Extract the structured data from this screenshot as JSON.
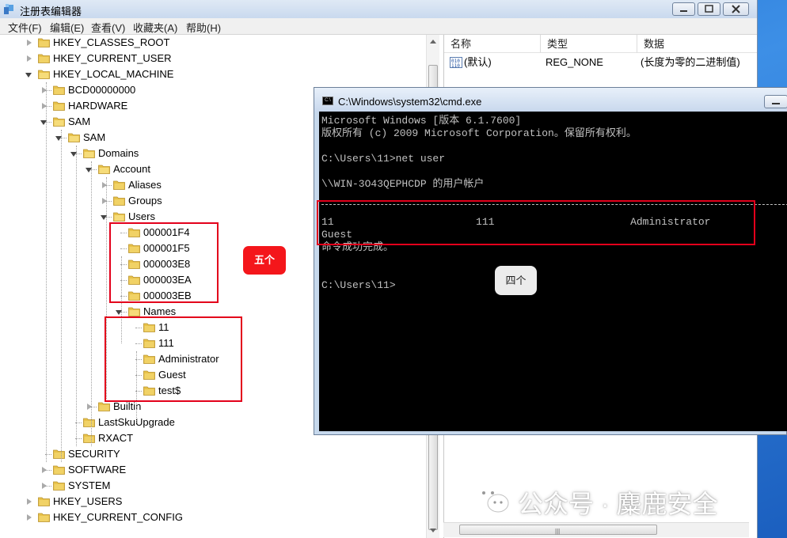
{
  "window": {
    "title": "注册表编辑器",
    "menu": [
      "文件(F)",
      "编辑(E)",
      "查看(V)",
      "收藏夹(A)",
      "帮助(H)"
    ]
  },
  "tree": {
    "items": [
      {
        "label": "HKEY_CLASSES_ROOT",
        "state": "collapsed"
      },
      {
        "label": "HKEY_CURRENT_USER",
        "state": "collapsed"
      },
      {
        "label": "HKEY_LOCAL_MACHINE",
        "state": "expanded"
      },
      {
        "label": "BCD00000000",
        "state": "collapsed"
      },
      {
        "label": "HARDWARE",
        "state": "collapsed"
      },
      {
        "label": "SAM",
        "state": "expanded"
      },
      {
        "label": "SAM",
        "state": "expanded"
      },
      {
        "label": "Domains",
        "state": "expanded"
      },
      {
        "label": "Account",
        "state": "expanded"
      },
      {
        "label": "Aliases",
        "state": "collapsed"
      },
      {
        "label": "Groups",
        "state": "collapsed"
      },
      {
        "label": "Users",
        "state": "expanded"
      },
      {
        "label": "000001F4",
        "state": "leaf"
      },
      {
        "label": "000001F5",
        "state": "leaf"
      },
      {
        "label": "000003E8",
        "state": "leaf"
      },
      {
        "label": "000003EA",
        "state": "leaf"
      },
      {
        "label": "000003EB",
        "state": "leaf"
      },
      {
        "label": "Names",
        "state": "expanded"
      },
      {
        "label": "11",
        "state": "leaf"
      },
      {
        "label": "111",
        "state": "leaf"
      },
      {
        "label": "Administrator",
        "state": "leaf"
      },
      {
        "label": "Guest",
        "state": "leaf"
      },
      {
        "label": "test$",
        "state": "leaf"
      },
      {
        "label": "Builtin",
        "state": "collapsed"
      },
      {
        "label": "LastSkuUpgrade",
        "state": "leaf"
      },
      {
        "label": "RXACT",
        "state": "leaf"
      },
      {
        "label": "SECURITY",
        "state": "leaf"
      },
      {
        "label": "SOFTWARE",
        "state": "collapsed"
      },
      {
        "label": "SYSTEM",
        "state": "collapsed"
      },
      {
        "label": "HKEY_USERS",
        "state": "collapsed"
      },
      {
        "label": "HKEY_CURRENT_CONFIG",
        "state": "collapsed"
      }
    ]
  },
  "values": {
    "headers": [
      "名称",
      "类型",
      "数据"
    ],
    "rows": [
      {
        "name": "(默认)",
        "type": "REG_NONE",
        "data": "(长度为零的二进制值)"
      }
    ]
  },
  "cmd": {
    "title": "C:\\Windows\\system32\\cmd.exe",
    "lines": [
      "Microsoft Windows [版本 6.1.7600]",
      "版权所有 (c) 2009 Microsoft Corporation。保留所有权利。",
      "",
      "C:\\Users\\11>net user",
      "",
      "\\\\WIN-3O43QEPHCDP 的用户帐户",
      "",
      "",
      "11                       111                      Administrator",
      "Guest",
      "命令成功完成。",
      "",
      "",
      "C:\\Users\\11>"
    ]
  },
  "annotations": {
    "five": "五个",
    "four": "四个"
  },
  "watermark": "公众号 · 麋鹿安全",
  "colors": {
    "annotation_red": "#e3001b",
    "badge_red": "#f4161b",
    "folder": "#e8c24a"
  }
}
